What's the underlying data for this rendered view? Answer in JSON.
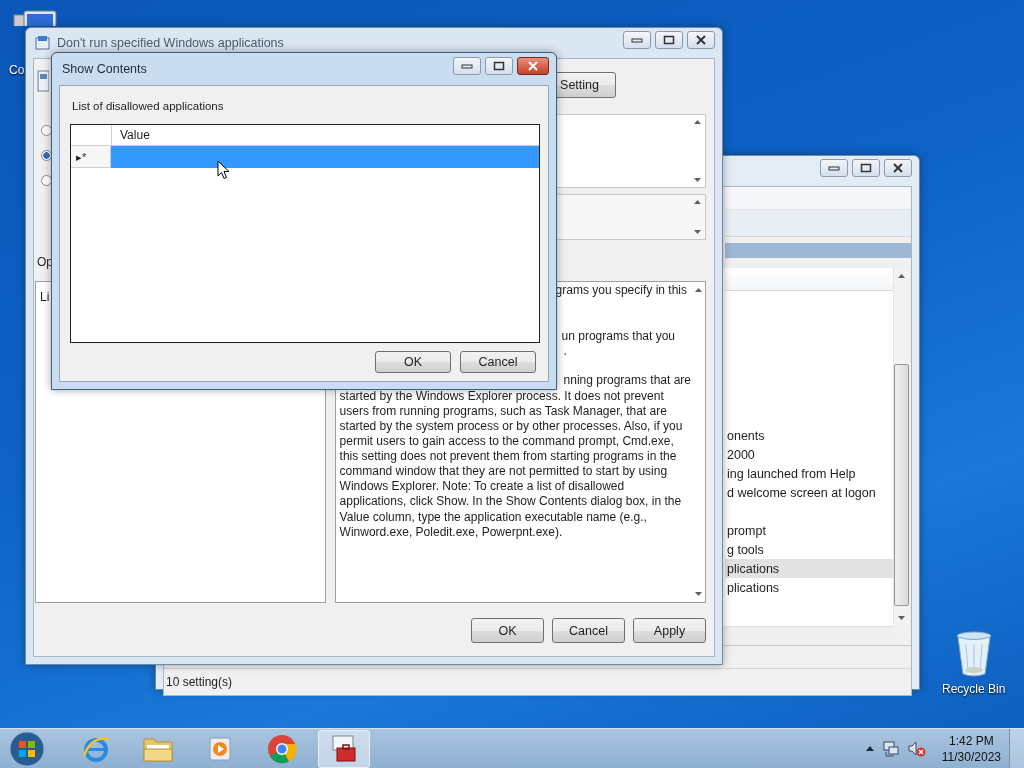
{
  "desktop_icons": [
    {
      "kind": "computer",
      "label": "Co"
    },
    {
      "kind": "recycle",
      "label": "Recycle Bin"
    }
  ],
  "back_window": {
    "items": [
      {
        "text": "onents",
        "selected": false
      },
      {
        "text": "2000",
        "selected": false
      },
      {
        "text": "ing launched from Help",
        "selected": false
      },
      {
        "text": "d welcome screen at logon",
        "selected": false
      },
      {
        "text": "prompt",
        "selected": false
      },
      {
        "text": "g tools",
        "selected": false
      },
      {
        "text": "plications",
        "selected": true
      },
      {
        "text": "plications",
        "selected": false
      }
    ],
    "status_bar": "10 setting(s)"
  },
  "setting_window": {
    "title": "Don't run specified Windows applications",
    "nav_button": "Setting",
    "radios": [
      {
        "selected": false
      },
      {
        "selected": true
      },
      {
        "selected": false
      }
    ],
    "options_label": "Op",
    "options_text": "Li",
    "help_fragments": [
      "grams you specify in this",
      "un programs that you",
      ".",
      "nning programs that are"
    ],
    "help_lines": [
      "started by the Windows Explorer process. It does not prevent",
      "users from running programs, such as Task Manager, that are",
      "started by the system process or by other processes. Also, if you",
      "permit users to gain access to the command prompt, Cmd.exe,",
      "this setting does not prevent them from starting programs in the",
      "command window that they are not permitted to start by using",
      "Windows Explorer. Note: To create a list of disallowed",
      "applications, click Show. In the Show Contents dialog box, in the",
      "Value column, type the application executable name (e.g.,",
      "Winword.exe, Poledit.exe, Powerpnt.exe)."
    ],
    "buttons": [
      "OK",
      "Cancel",
      "Apply"
    ]
  },
  "dialog": {
    "title": "Show Contents",
    "label": "List of disallowed applications",
    "column": "Value",
    "rows": [
      {
        "marker": "▸*",
        "selected": true
      }
    ],
    "buttons": [
      "OK",
      "Cancel"
    ]
  },
  "taskbar": {
    "apps": [
      {
        "kind": "browser-e",
        "active": false
      },
      {
        "kind": "folder",
        "active": false
      },
      {
        "kind": "media",
        "active": false
      },
      {
        "kind": "chrome",
        "active": false
      },
      {
        "kind": "toolbox",
        "active": true
      }
    ],
    "volume_muted": true,
    "time": "1:42 PM",
    "date": "11/30/2023"
  }
}
